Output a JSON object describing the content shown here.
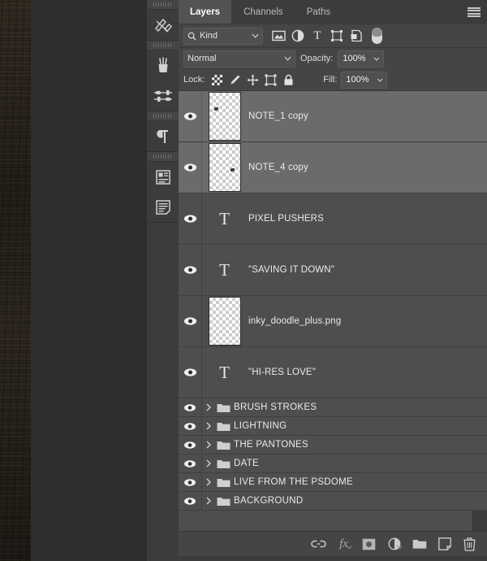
{
  "window": {
    "panel_title": "Layers"
  },
  "dock": {
    "groups": [
      {
        "icons": [
          {
            "name": "styles-icon",
            "label": "Styles"
          }
        ]
      },
      {
        "icons": [
          {
            "name": "brushes-icon",
            "label": "Brushes"
          },
          {
            "name": "brush-settings-icon",
            "label": "Brush Settings"
          }
        ]
      },
      {
        "icons": [
          {
            "name": "paragraph-icon",
            "label": "Paragraph"
          }
        ]
      },
      {
        "icons": [
          {
            "name": "character-styles-icon",
            "label": "Character Styles"
          },
          {
            "name": "paragraph-styles-icon",
            "label": "Paragraph Styles"
          }
        ]
      }
    ]
  },
  "tabs": [
    {
      "label": "Layers",
      "active": true
    },
    {
      "label": "Channels",
      "active": false
    },
    {
      "label": "Paths",
      "active": false
    }
  ],
  "panel_menu": {
    "name": "panel-menu-icon",
    "label": "Panel Menu"
  },
  "filter_row": {
    "kind_label": "Kind",
    "search_icon": "search-icon",
    "filter_icons": [
      {
        "name": "filter-pixel-icon",
        "label": "Pixel Layers"
      },
      {
        "name": "filter-adjustment-icon",
        "label": "Adjustment Layers"
      },
      {
        "name": "filter-type-icon",
        "label": "Type Layers"
      },
      {
        "name": "filter-shape-icon",
        "label": "Shape Layers"
      },
      {
        "name": "filter-smart-object-icon",
        "label": "Smart Objects"
      }
    ],
    "toggle": {
      "name": "filter-toggle-switch",
      "state": "on"
    }
  },
  "blend_row": {
    "blend_mode": "Normal",
    "opacity_label": "Opacity:",
    "opacity_value": "100%"
  },
  "lock_row": {
    "lock_label": "Lock:",
    "lock_icons": [
      {
        "name": "lock-transparency-icon",
        "label": "Lock transparent pixels"
      },
      {
        "name": "lock-image-icon",
        "label": "Lock image pixels"
      },
      {
        "name": "lock-position-icon",
        "label": "Lock position"
      },
      {
        "name": "lock-artboard-icon",
        "label": "Prevent auto-nesting"
      },
      {
        "name": "lock-all-icon",
        "label": "Lock all"
      }
    ],
    "fill_label": "Fill:",
    "fill_value": "100%"
  },
  "layers": [
    {
      "name": "NOTE_1 copy",
      "type": "raster",
      "selected": true,
      "visible": true,
      "fx": false,
      "group": false
    },
    {
      "name": "NOTE_4 copy",
      "type": "raster",
      "selected": true,
      "visible": true,
      "fx": false,
      "group": false
    },
    {
      "name": "PIXEL PUSHERS",
      "type": "text",
      "selected": false,
      "visible": true,
      "fx": true,
      "group": false
    },
    {
      "name": "\"SAVING IT DOWN\"",
      "type": "text",
      "selected": false,
      "visible": true,
      "fx": true,
      "group": false
    },
    {
      "name": "inky_doodle_plus.png",
      "type": "raster",
      "selected": false,
      "visible": true,
      "fx": true,
      "group": false
    },
    {
      "name": "\"HI-RES LOVE\"",
      "type": "text",
      "selected": false,
      "visible": true,
      "fx": true,
      "group": false
    },
    {
      "name": "BRUSH STROKES",
      "type": "group",
      "selected": false,
      "visible": true,
      "fx": true,
      "group": true
    },
    {
      "name": "LIGHTNING",
      "type": "group",
      "selected": false,
      "visible": true,
      "fx": true,
      "group": true
    },
    {
      "name": "THE PANTONES",
      "type": "group",
      "selected": false,
      "visible": true,
      "fx": false,
      "group": true
    },
    {
      "name": "DATE",
      "type": "group",
      "selected": false,
      "visible": true,
      "fx": false,
      "group": true
    },
    {
      "name": "LIVE FROM THE PSDOME",
      "type": "group",
      "selected": false,
      "visible": true,
      "fx": false,
      "group": true
    },
    {
      "name": "BACKGROUND",
      "type": "group",
      "selected": false,
      "visible": true,
      "fx": false,
      "group": true
    }
  ],
  "bottom_toolbar": [
    {
      "name": "link-layers-icon",
      "label": "Link layers"
    },
    {
      "name": "layer-style-fx-icon",
      "label": "Add a layer style"
    },
    {
      "name": "add-layer-mask-icon",
      "label": "Add layer mask"
    },
    {
      "name": "adjustment-layer-icon",
      "label": "Create new fill or adjustment layer"
    },
    {
      "name": "new-group-icon",
      "label": "Create a new group"
    },
    {
      "name": "new-layer-icon",
      "label": "Create a new layer"
    },
    {
      "name": "delete-layer-icon",
      "label": "Delete layer"
    }
  ],
  "colors": {
    "panel_bg": "#454545",
    "row_bg": "#4e4e4e",
    "row_selected_bg": "#6b6b6b",
    "tab_active_bg": "#535353",
    "text": "#eaeaea",
    "workspace_bg": "#2e2e2e"
  }
}
